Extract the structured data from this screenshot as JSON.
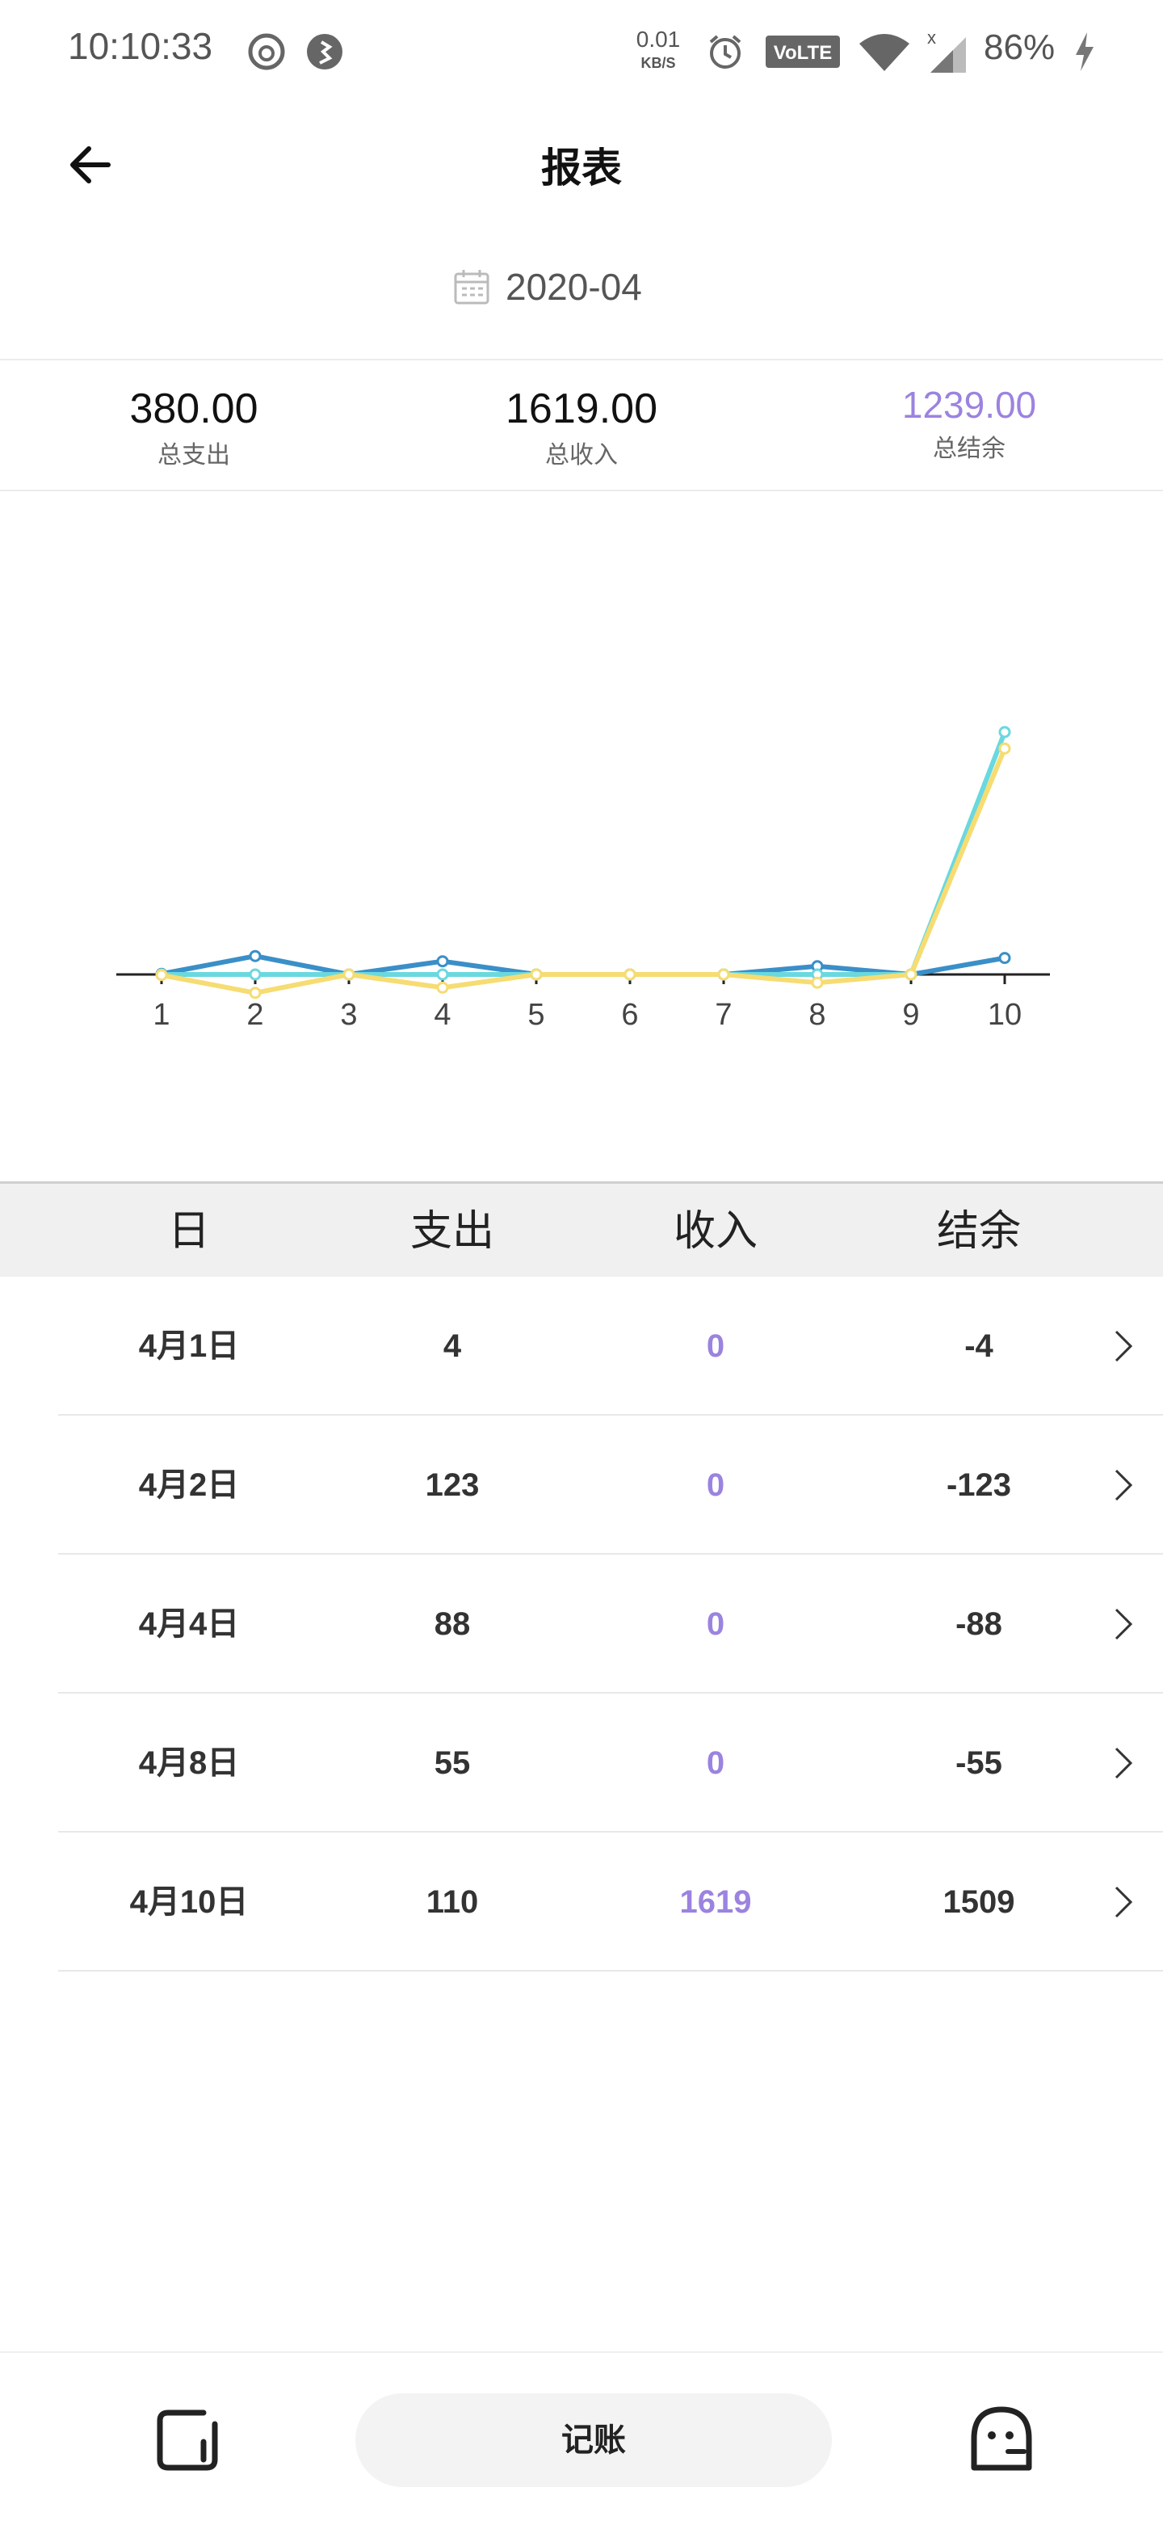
{
  "status_bar": {
    "time": "10:10:33",
    "net_speed_value": "0.01",
    "net_speed_unit": "KB/S",
    "volte": "VoLTE",
    "battery": "86%"
  },
  "header": {
    "title": "报表"
  },
  "month_picker": {
    "value": "2020-04"
  },
  "summary": {
    "expense": {
      "value": "380.00",
      "label": "总支出"
    },
    "income": {
      "value": "1619.00",
      "label": "总收入"
    },
    "balance": {
      "value": "1239.00",
      "label": "总结余"
    }
  },
  "chart_data": {
    "type": "line",
    "x": [
      "1",
      "2",
      "3",
      "4",
      "5",
      "6",
      "7",
      "8",
      "9",
      "10"
    ],
    "series": [
      {
        "values": [
          4,
          123,
          0,
          88,
          0,
          0,
          0,
          55,
          0,
          110
        ],
        "color": "#3a8fc8"
      },
      {
        "values": [
          0,
          0,
          0,
          0,
          0,
          0,
          0,
          0,
          0,
          1619
        ],
        "color": "#6ad8df"
      },
      {
        "values": [
          -4,
          -123,
          0,
          -88,
          0,
          0,
          0,
          -55,
          0,
          1509
        ],
        "color": "#f6dc72"
      }
    ],
    "ylim": [
      -200,
      2000
    ],
    "axis_color": "#222222",
    "grid": false,
    "legend": "none"
  },
  "table": {
    "headers": [
      "日",
      "支出",
      "收入",
      "结余"
    ],
    "rows": [
      {
        "day": "4月1日",
        "expense": "4",
        "income": "0",
        "balance": "-4"
      },
      {
        "day": "4月2日",
        "expense": "123",
        "income": "0",
        "balance": "-123"
      },
      {
        "day": "4月4日",
        "expense": "88",
        "income": "0",
        "balance": "-88"
      },
      {
        "day": "4月8日",
        "expense": "55",
        "income": "0",
        "balance": "-55"
      },
      {
        "day": "4月10日",
        "expense": "110",
        "income": "1619",
        "balance": "1509"
      }
    ]
  },
  "bottom_nav": {
    "record_label": "记账"
  },
  "colors": {
    "accent": "#9b83e0",
    "header_bg": "#f0f0f0"
  }
}
